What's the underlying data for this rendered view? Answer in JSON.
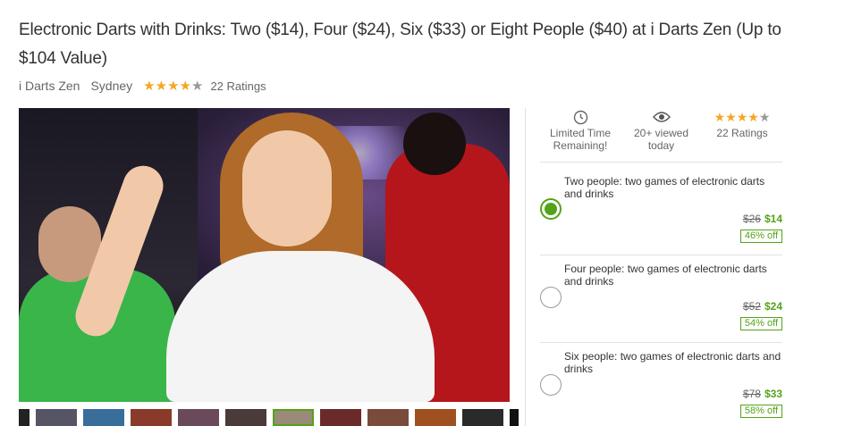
{
  "deal": {
    "title": "Electronic Darts with Drinks: Two ($14), Four ($24), Six ($33) or Eight People ($40) at i Darts Zen (Up to $104 Value)",
    "merchant": "i Darts Zen",
    "location": "Sydney",
    "rating_stars": 4,
    "ratings_label": "22 Ratings"
  },
  "stats": {
    "time": {
      "icon": "clock-icon",
      "line1": "Limited Time",
      "line2": "Remaining!"
    },
    "views": {
      "icon": "eye-icon",
      "line1": "20+ viewed",
      "line2": "today"
    },
    "ratings": {
      "icon": "star-rating-icon",
      "label": "22 Ratings"
    }
  },
  "options": [
    {
      "title": "Two people: two games of electronic darts and drinks",
      "was": "$26",
      "now": "$14",
      "discount": "46% off",
      "selected": true
    },
    {
      "title": "Four people: two games of electronic darts and drinks",
      "was": "$52",
      "now": "$24",
      "discount": "54% off",
      "selected": false
    },
    {
      "title": "Six people: two games of electronic darts and drinks",
      "was": "$78",
      "now": "$33",
      "discount": "58% off",
      "selected": false
    }
  ],
  "colors": {
    "accent_green": "#53a318",
    "star_gold": "#f5a623"
  }
}
